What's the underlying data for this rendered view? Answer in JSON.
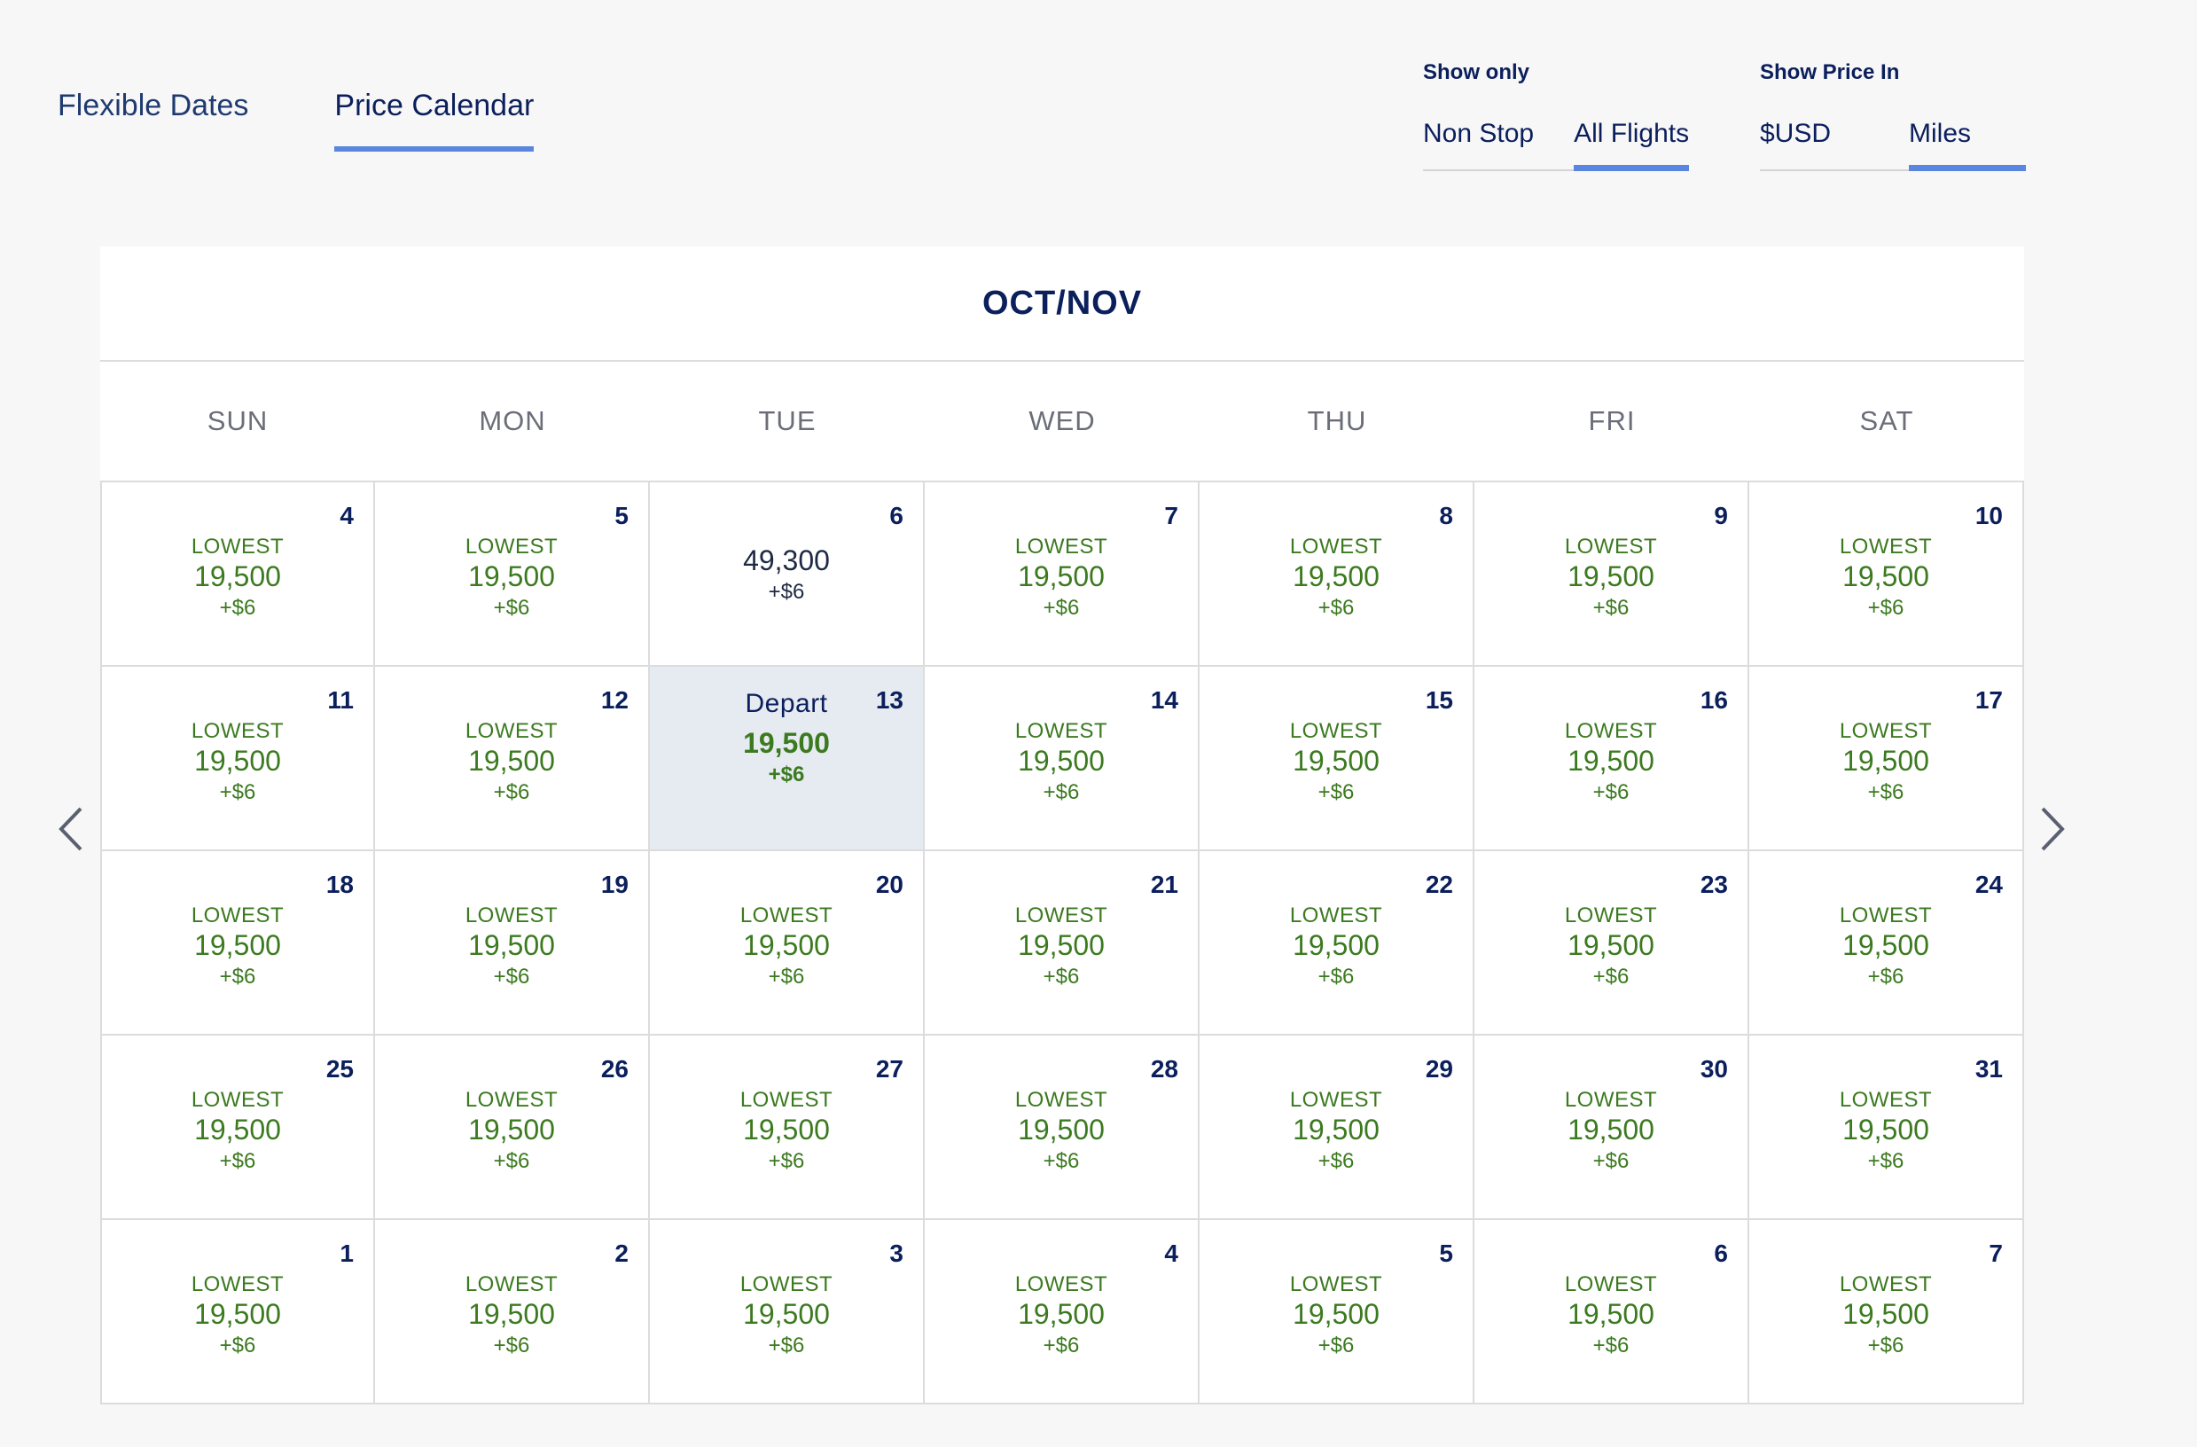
{
  "view_tabs": [
    {
      "label": "Flexible Dates",
      "active": false
    },
    {
      "label": "Price Calendar",
      "active": true
    }
  ],
  "filters": {
    "show_only": {
      "label": "Show only",
      "options": [
        "Non Stop",
        "All Flights"
      ],
      "selected": "All Flights"
    },
    "price_in": {
      "label": "Show Price In",
      "options": [
        "$USD",
        "Miles"
      ],
      "selected": "Miles"
    }
  },
  "calendar": {
    "title": "OCT/NOV",
    "weekdays": [
      "SUN",
      "MON",
      "TUE",
      "WED",
      "THU",
      "FRI",
      "SAT"
    ],
    "cells": [
      {
        "day": "4",
        "tag": "LOWEST",
        "miles": "19,500",
        "fee": "+$6"
      },
      {
        "day": "5",
        "tag": "LOWEST",
        "miles": "19,500",
        "fee": "+$6"
      },
      {
        "day": "6",
        "tag": "",
        "miles": "49,300",
        "fee": "+$6"
      },
      {
        "day": "7",
        "tag": "LOWEST",
        "miles": "19,500",
        "fee": "+$6"
      },
      {
        "day": "8",
        "tag": "LOWEST",
        "miles": "19,500",
        "fee": "+$6"
      },
      {
        "day": "9",
        "tag": "LOWEST",
        "miles": "19,500",
        "fee": "+$6"
      },
      {
        "day": "10",
        "tag": "LOWEST",
        "miles": "19,500",
        "fee": "+$6"
      },
      {
        "day": "11",
        "tag": "LOWEST",
        "miles": "19,500",
        "fee": "+$6"
      },
      {
        "day": "12",
        "tag": "LOWEST",
        "miles": "19,500",
        "fee": "+$6"
      },
      {
        "day": "13",
        "tag": "Depart",
        "miles": "19,500",
        "fee": "+$6",
        "selected": true
      },
      {
        "day": "14",
        "tag": "LOWEST",
        "miles": "19,500",
        "fee": "+$6"
      },
      {
        "day": "15",
        "tag": "LOWEST",
        "miles": "19,500",
        "fee": "+$6"
      },
      {
        "day": "16",
        "tag": "LOWEST",
        "miles": "19,500",
        "fee": "+$6"
      },
      {
        "day": "17",
        "tag": "LOWEST",
        "miles": "19,500",
        "fee": "+$6"
      },
      {
        "day": "18",
        "tag": "LOWEST",
        "miles": "19,500",
        "fee": "+$6"
      },
      {
        "day": "19",
        "tag": "LOWEST",
        "miles": "19,500",
        "fee": "+$6"
      },
      {
        "day": "20",
        "tag": "LOWEST",
        "miles": "19,500",
        "fee": "+$6"
      },
      {
        "day": "21",
        "tag": "LOWEST",
        "miles": "19,500",
        "fee": "+$6"
      },
      {
        "day": "22",
        "tag": "LOWEST",
        "miles": "19,500",
        "fee": "+$6"
      },
      {
        "day": "23",
        "tag": "LOWEST",
        "miles": "19,500",
        "fee": "+$6"
      },
      {
        "day": "24",
        "tag": "LOWEST",
        "miles": "19,500",
        "fee": "+$6"
      },
      {
        "day": "25",
        "tag": "LOWEST",
        "miles": "19,500",
        "fee": "+$6"
      },
      {
        "day": "26",
        "tag": "LOWEST",
        "miles": "19,500",
        "fee": "+$6"
      },
      {
        "day": "27",
        "tag": "LOWEST",
        "miles": "19,500",
        "fee": "+$6"
      },
      {
        "day": "28",
        "tag": "LOWEST",
        "miles": "19,500",
        "fee": "+$6"
      },
      {
        "day": "29",
        "tag": "LOWEST",
        "miles": "19,500",
        "fee": "+$6"
      },
      {
        "day": "30",
        "tag": "LOWEST",
        "miles": "19,500",
        "fee": "+$6"
      },
      {
        "day": "31",
        "tag": "LOWEST",
        "miles": "19,500",
        "fee": "+$6"
      },
      {
        "day": "1",
        "tag": "LOWEST",
        "miles": "19,500",
        "fee": "+$6"
      },
      {
        "day": "2",
        "tag": "LOWEST",
        "miles": "19,500",
        "fee": "+$6"
      },
      {
        "day": "3",
        "tag": "LOWEST",
        "miles": "19,500",
        "fee": "+$6"
      },
      {
        "day": "4",
        "tag": "LOWEST",
        "miles": "19,500",
        "fee": "+$6"
      },
      {
        "day": "5",
        "tag": "LOWEST",
        "miles": "19,500",
        "fee": "+$6"
      },
      {
        "day": "6",
        "tag": "LOWEST",
        "miles": "19,500",
        "fee": "+$6"
      },
      {
        "day": "7",
        "tag": "LOWEST",
        "miles": "19,500",
        "fee": "+$6"
      }
    ]
  },
  "nav": {
    "prev_icon": "chevron-left-icon",
    "next_icon": "chevron-right-icon"
  },
  "colors": {
    "accent": "#5b86e0",
    "navy": "#0b1f5c",
    "green": "#3c7a20",
    "selected_bg": "#e6eaf1"
  }
}
